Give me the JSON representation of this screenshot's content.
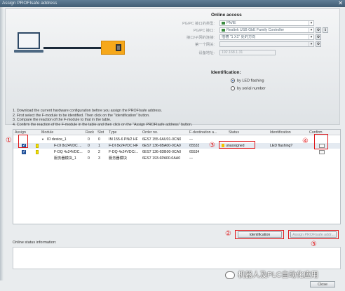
{
  "window": {
    "title": "Assign PROFIsafe address",
    "close_glyph": "✕"
  },
  "online_access": {
    "title": "Online access",
    "rows": [
      {
        "label": "PG/PC 接口的类型:",
        "value": "PN/IE",
        "grey": false
      },
      {
        "label": "PG/PC 接口:",
        "value": "Realtek USB GbE Family Controller",
        "grey": false
      },
      {
        "label": "接口/子网的连接:",
        "value": "插槽 \"1 X1\" 处的方向",
        "grey": false
      },
      {
        "label": "第一个网关:",
        "value": "",
        "grey": true
      },
      {
        "label": "设备地址:",
        "value": "192.168.1.31",
        "grey": true
      }
    ],
    "btn_glyph_a": "⚙",
    "btn_glyph_b": "ℹ"
  },
  "identification": {
    "title": "Identification:",
    "options": [
      {
        "label": "by LED flashing",
        "selected": true
      },
      {
        "label": "by serial number",
        "selected": false
      }
    ]
  },
  "steps": [
    "1. Download the current hardware configuration before you assign the PROFIsafe address.",
    "2. First select the F-module to be identified. Then click on the \"Identification\" button.",
    "3. Compare the reaction of the F-module to that in the table.",
    "4. Confirm the reaction of the F-module in the table and then click on the \"Assign PROFIsafe address\" button."
  ],
  "table": {
    "headers": {
      "assign": "Assign",
      "module": "Module",
      "rack": "Rack",
      "slot": "Slot",
      "type": "Type",
      "order": "Order no.",
      "fdest": "F-destination a...",
      "status": "Status",
      "ident": "Identification",
      "confirm": "Confirm"
    },
    "rows": [
      {
        "assign": false,
        "showchk": false,
        "yellow": false,
        "arrow": "▼",
        "module": "IO device_1",
        "rack": "0",
        "slot": "0",
        "type": "IM 155-6 PN/2 HF",
        "order": "6ES7 155-6AU01-0CN0",
        "fdest": "—",
        "status": "",
        "ident": "",
        "confirm": false
      },
      {
        "assign": true,
        "showchk": true,
        "yellow": true,
        "arrow": "",
        "module": "F-DI 8x24VDC ...",
        "rack": "0",
        "slot": "1",
        "type": "F-DI 8x24VDC HF",
        "order": "6ES7 136-6BA00-0CA0",
        "fdest": "65533",
        "status": "unassigned",
        "ident": "LED flashing?",
        "confirm": true
      },
      {
        "assign": true,
        "showchk": true,
        "yellow": true,
        "arrow": "",
        "module": "F-DQ 4x24VDC...",
        "rack": "0",
        "slot": "2",
        "type": "F-DQ 4x24VDC/...",
        "order": "6ES7 136-6DB00-0CA0",
        "fdest": "65534",
        "status": "",
        "ident": "",
        "confirm": true
      },
      {
        "assign": false,
        "showchk": false,
        "yellow": false,
        "arrow": "",
        "module": "服务器模块_1",
        "rack": "0",
        "slot": "3",
        "type": "服务器模块",
        "order": "6ES7 193-6PA00-0AA0",
        "fdest": "—",
        "status": "",
        "ident": "",
        "confirm": false
      }
    ]
  },
  "annotations": [
    "①",
    "②",
    "③",
    "④",
    "⑤"
  ],
  "buttons": {
    "identification": "Identification",
    "assign": "Assign PROFIsafe addr...",
    "close": "Close"
  },
  "status": {
    "label": "Online status information:"
  },
  "watermark": "机器人及PLC自动化应用",
  "colors": {
    "accent_red": "#e0191c",
    "device_orange": "#f6a81b",
    "title_blue": "#4a6680"
  }
}
